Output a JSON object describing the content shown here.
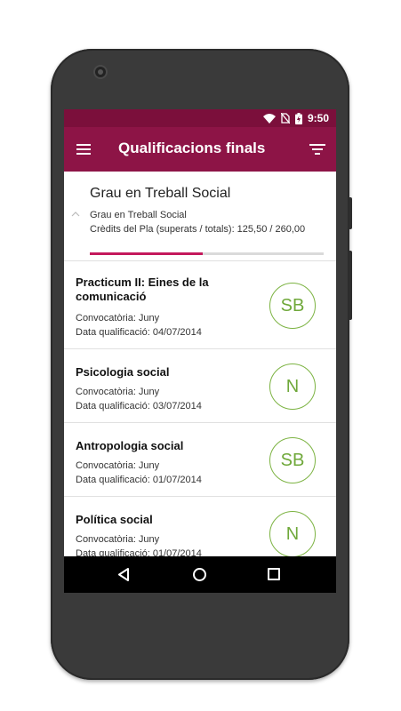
{
  "status_bar": {
    "time": "9:50",
    "icons": [
      "wifi-icon",
      "no-sim-icon",
      "battery-charging-icon"
    ]
  },
  "toolbar": {
    "title": "Qualificacions finals",
    "menu_icon": "hamburger-menu-icon",
    "filter_icon": "filter-icon"
  },
  "degree": {
    "title": "Grau en Treball Social",
    "subtitle": "Grau en Treball Social",
    "credits_text": "Crèdits del Pla (superats / totals): 125,50 / 260,00",
    "credits_passed": 125.5,
    "credits_total": 260.0,
    "progress_fraction": 0.483
  },
  "grades": [
    {
      "subject": "Practicum II: Eines de la comunicació",
      "convocatoria": "Convocatòria: Juny",
      "data": "Data qualificació: 04/07/2014",
      "grade": "SB"
    },
    {
      "subject": "Psicologia social",
      "convocatoria": "Convocatòria: Juny",
      "data": "Data qualificació: 03/07/2014",
      "grade": "N"
    },
    {
      "subject": "Antropologia social",
      "convocatoria": "Convocatòria: Juny",
      "data": "Data qualificació: 01/07/2014",
      "grade": "SB"
    },
    {
      "subject": "Política social",
      "convocatoria": "Convocatòria: Juny",
      "data": "Data qualificació: 01/07/2014",
      "grade": "N"
    }
  ],
  "colors": {
    "status_bar": "#7b0f3b",
    "toolbar": "#8d1446",
    "progress": "#c4195c",
    "grade_circle": "#7cb342"
  }
}
